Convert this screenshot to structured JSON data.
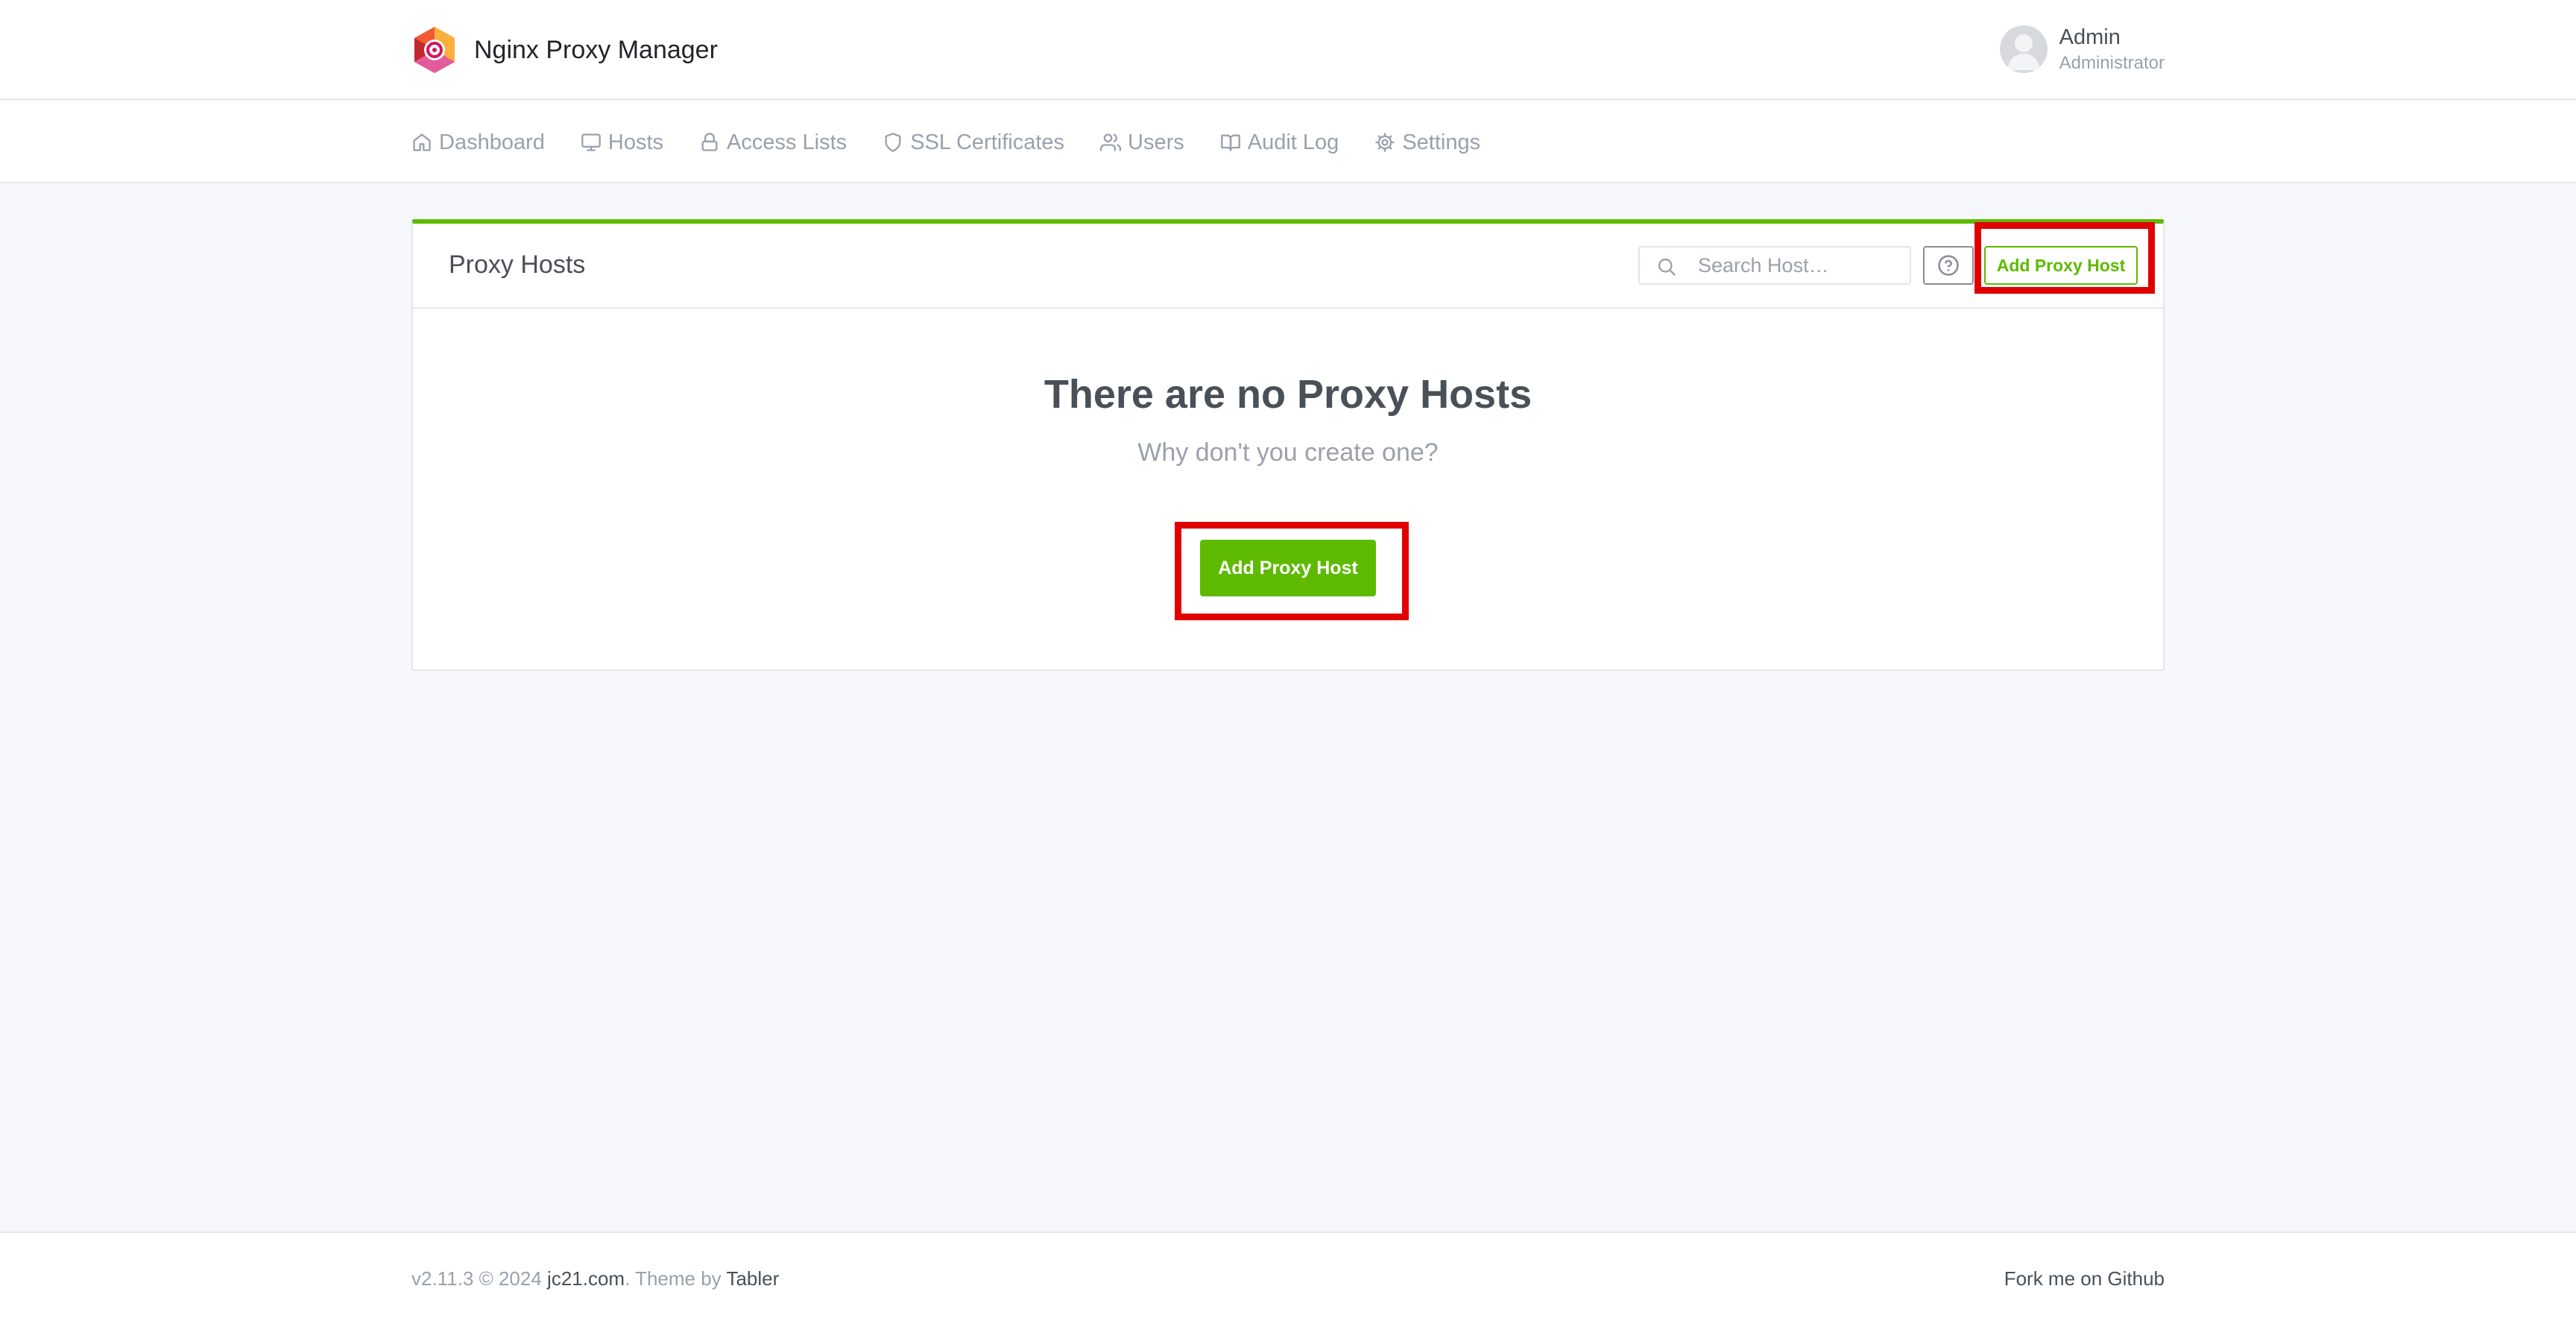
{
  "header": {
    "brand_name": "Nginx Proxy Manager",
    "user_name": "Admin",
    "user_role": "Administrator"
  },
  "nav": {
    "items": [
      {
        "label": "Dashboard",
        "icon": "home-icon"
      },
      {
        "label": "Hosts",
        "icon": "monitor-icon"
      },
      {
        "label": "Access Lists",
        "icon": "lock-icon"
      },
      {
        "label": "SSL Certificates",
        "icon": "shield-icon"
      },
      {
        "label": "Users",
        "icon": "users-icon"
      },
      {
        "label": "Audit Log",
        "icon": "book-icon"
      },
      {
        "label": "Settings",
        "icon": "gear-icon"
      }
    ]
  },
  "card": {
    "title": "Proxy Hosts",
    "search_placeholder": "Search Host…",
    "help_icon": "help-circle-icon",
    "add_button_label": "Add Proxy Host",
    "empty_title": "There are no Proxy Hosts",
    "empty_subtitle": "Why don't you create one?",
    "empty_button_label": "Add Proxy Host"
  },
  "footer": {
    "version": "v2.11.3 © 2024",
    "author_link": "jc21.com",
    "theme_text": ". Theme by",
    "theme_link": "Tabler",
    "github_link": "Fork me on Github"
  },
  "colors": {
    "accent": "#5eba00",
    "highlight": "#e00000",
    "background": "#f5f7fb"
  }
}
